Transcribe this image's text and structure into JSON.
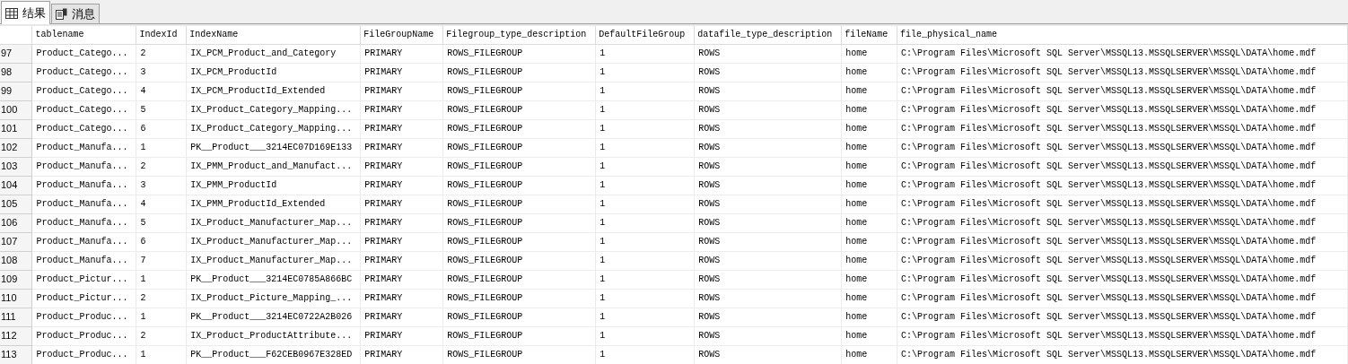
{
  "tabs": [
    {
      "label": "结果",
      "kind": "grid",
      "selected": true
    },
    {
      "label": "消息",
      "kind": "messages",
      "selected": false
    }
  ],
  "table": {
    "columns": [
      "tablename",
      "IndexId",
      "IndexName",
      "FileGroupName",
      "Filegroup_type_description",
      "DefaultFileGroup",
      "datafile_type_description",
      "fileName",
      "file_physical_name"
    ],
    "rows": [
      {
        "number": "97",
        "cells": [
          "Product_Catego...",
          "2",
          "IX_PCM_Product_and_Category",
          "PRIMARY",
          "ROWS_FILEGROUP",
          "1",
          "ROWS",
          "home",
          "C:\\Program Files\\Microsoft SQL Server\\MSSQL13.MSSQLSERVER\\MSSQL\\DATA\\home.mdf"
        ]
      },
      {
        "number": "98",
        "cells": [
          "Product_Catego...",
          "3",
          "IX_PCM_ProductId",
          "PRIMARY",
          "ROWS_FILEGROUP",
          "1",
          "ROWS",
          "home",
          "C:\\Program Files\\Microsoft SQL Server\\MSSQL13.MSSQLSERVER\\MSSQL\\DATA\\home.mdf"
        ]
      },
      {
        "number": "99",
        "cells": [
          "Product_Catego...",
          "4",
          "IX_PCM_ProductId_Extended",
          "PRIMARY",
          "ROWS_FILEGROUP",
          "1",
          "ROWS",
          "home",
          "C:\\Program Files\\Microsoft SQL Server\\MSSQL13.MSSQLSERVER\\MSSQL\\DATA\\home.mdf"
        ]
      },
      {
        "number": "100",
        "cells": [
          "Product_Catego...",
          "5",
          "IX_Product_Category_Mapping...",
          "PRIMARY",
          "ROWS_FILEGROUP",
          "1",
          "ROWS",
          "home",
          "C:\\Program Files\\Microsoft SQL Server\\MSSQL13.MSSQLSERVER\\MSSQL\\DATA\\home.mdf"
        ]
      },
      {
        "number": "101",
        "cells": [
          "Product_Catego...",
          "6",
          "IX_Product_Category_Mapping...",
          "PRIMARY",
          "ROWS_FILEGROUP",
          "1",
          "ROWS",
          "home",
          "C:\\Program Files\\Microsoft SQL Server\\MSSQL13.MSSQLSERVER\\MSSQL\\DATA\\home.mdf"
        ]
      },
      {
        "number": "102",
        "cells": [
          "Product_Manufa...",
          "1",
          "PK__Product___3214EC07D169E133",
          "PRIMARY",
          "ROWS_FILEGROUP",
          "1",
          "ROWS",
          "home",
          "C:\\Program Files\\Microsoft SQL Server\\MSSQL13.MSSQLSERVER\\MSSQL\\DATA\\home.mdf"
        ]
      },
      {
        "number": "103",
        "cells": [
          "Product_Manufa...",
          "2",
          "IX_PMM_Product_and_Manufact...",
          "PRIMARY",
          "ROWS_FILEGROUP",
          "1",
          "ROWS",
          "home",
          "C:\\Program Files\\Microsoft SQL Server\\MSSQL13.MSSQLSERVER\\MSSQL\\DATA\\home.mdf"
        ]
      },
      {
        "number": "104",
        "cells": [
          "Product_Manufa...",
          "3",
          "IX_PMM_ProductId",
          "PRIMARY",
          "ROWS_FILEGROUP",
          "1",
          "ROWS",
          "home",
          "C:\\Program Files\\Microsoft SQL Server\\MSSQL13.MSSQLSERVER\\MSSQL\\DATA\\home.mdf"
        ]
      },
      {
        "number": "105",
        "cells": [
          "Product_Manufa...",
          "4",
          "IX_PMM_ProductId_Extended",
          "PRIMARY",
          "ROWS_FILEGROUP",
          "1",
          "ROWS",
          "home",
          "C:\\Program Files\\Microsoft SQL Server\\MSSQL13.MSSQLSERVER\\MSSQL\\DATA\\home.mdf"
        ]
      },
      {
        "number": "106",
        "cells": [
          "Product_Manufa...",
          "5",
          "IX_Product_Manufacturer_Map...",
          "PRIMARY",
          "ROWS_FILEGROUP",
          "1",
          "ROWS",
          "home",
          "C:\\Program Files\\Microsoft SQL Server\\MSSQL13.MSSQLSERVER\\MSSQL\\DATA\\home.mdf"
        ]
      },
      {
        "number": "107",
        "cells": [
          "Product_Manufa...",
          "6",
          "IX_Product_Manufacturer_Map...",
          "PRIMARY",
          "ROWS_FILEGROUP",
          "1",
          "ROWS",
          "home",
          "C:\\Program Files\\Microsoft SQL Server\\MSSQL13.MSSQLSERVER\\MSSQL\\DATA\\home.mdf"
        ]
      },
      {
        "number": "108",
        "cells": [
          "Product_Manufa...",
          "7",
          "IX_Product_Manufacturer_Map...",
          "PRIMARY",
          "ROWS_FILEGROUP",
          "1",
          "ROWS",
          "home",
          "C:\\Program Files\\Microsoft SQL Server\\MSSQL13.MSSQLSERVER\\MSSQL\\DATA\\home.mdf"
        ]
      },
      {
        "number": "109",
        "cells": [
          "Product_Pictur...",
          "1",
          "PK__Product___3214EC0785A866BC",
          "PRIMARY",
          "ROWS_FILEGROUP",
          "1",
          "ROWS",
          "home",
          "C:\\Program Files\\Microsoft SQL Server\\MSSQL13.MSSQLSERVER\\MSSQL\\DATA\\home.mdf"
        ]
      },
      {
        "number": "110",
        "cells": [
          "Product_Pictur...",
          "2",
          "IX_Product_Picture_Mapping_...",
          "PRIMARY",
          "ROWS_FILEGROUP",
          "1",
          "ROWS",
          "home",
          "C:\\Program Files\\Microsoft SQL Server\\MSSQL13.MSSQLSERVER\\MSSQL\\DATA\\home.mdf"
        ]
      },
      {
        "number": "111",
        "cells": [
          "Product_Produc...",
          "1",
          "PK__Product___3214EC0722A2B026",
          "PRIMARY",
          "ROWS_FILEGROUP",
          "1",
          "ROWS",
          "home",
          "C:\\Program Files\\Microsoft SQL Server\\MSSQL13.MSSQLSERVER\\MSSQL\\DATA\\home.mdf"
        ]
      },
      {
        "number": "112",
        "cells": [
          "Product_Produc...",
          "2",
          "IX_Product_ProductAttribute...",
          "PRIMARY",
          "ROWS_FILEGROUP",
          "1",
          "ROWS",
          "home",
          "C:\\Program Files\\Microsoft SQL Server\\MSSQL13.MSSQLSERVER\\MSSQL\\DATA\\home.mdf"
        ]
      },
      {
        "number": "113",
        "cells": [
          "Product_Produc...",
          "1",
          "PK__Product___F62CEB0967E328ED",
          "PRIMARY",
          "ROWS_FILEGROUP",
          "1",
          "ROWS",
          "home",
          "C:\\Program Files\\Microsoft SQL Server\\MSSQL13.MSSQLSERVER\\MSSQL\\DATA\\home.mdf"
        ]
      }
    ]
  }
}
